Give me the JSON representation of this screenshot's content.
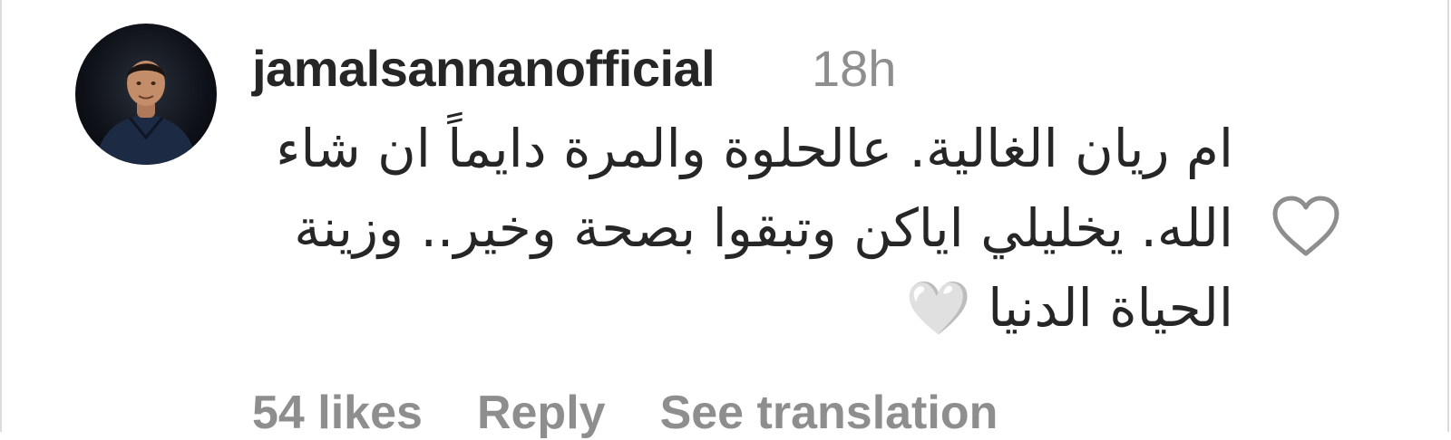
{
  "comment": {
    "username": "jamalsannanofficial",
    "time": "18h",
    "text": "ام ريان الغالية. عالحلوة والمرة دايماً ان شاء الله. يخليلي اياكن وتبقوا بصحة وخير.. وزينة الحياة الدنيا 🤍",
    "avatar_icon": "profile-photo",
    "like_icon": "heart-outline-icon"
  },
  "actions": {
    "likes": "54 likes",
    "reply": "Reply",
    "translate": "See translation"
  },
  "colors": {
    "text_primary": "#262626",
    "text_secondary": "#8e8e8e",
    "border": "#dbdbdb"
  }
}
